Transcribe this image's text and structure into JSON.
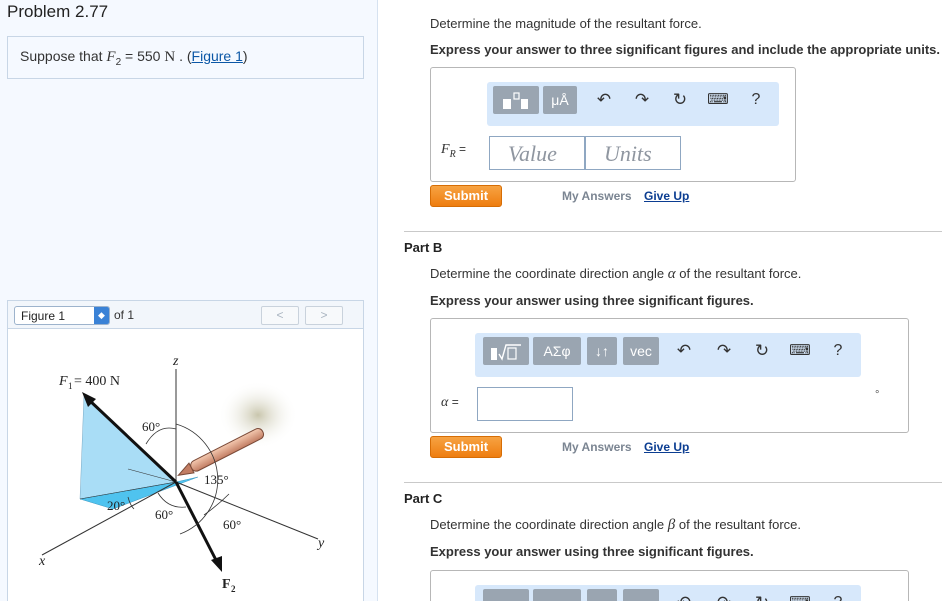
{
  "problem": {
    "title": "Problem 2.77",
    "statement_prefix": "Suppose that ",
    "statement_var": "F",
    "statement_sub": "2",
    "statement_eq": " = 550 ",
    "statement_unit": "N",
    "statement_sep": " . (",
    "figure_link": "Figure 1",
    "statement_suffix": ")"
  },
  "figure_nav": {
    "selected": "Figure 1",
    "of_text": "of 1",
    "prev": "<",
    "next": ">"
  },
  "figure": {
    "f1_label": "F",
    "f1_sub": "1",
    "f1_value": " = 400 N",
    "z_axis": "z",
    "x_axis": "x",
    "y_axis": "y",
    "angle_60a": "60°",
    "angle_135": "135°",
    "angle_20": "20°",
    "angle_60b": "60°",
    "angle_60c": "60°",
    "f2_label": "F",
    "f2_sub": "2"
  },
  "part_a": {
    "question": "Determine the magnitude of the resultant force.",
    "instruction": "Express your answer to three significant figures and include the appropriate units.",
    "toolbar": {
      "units_btn": "μÅ",
      "help": "?"
    },
    "field_label_main": "F",
    "field_label_sub": "R",
    "field_eq": " =",
    "value_placeholder": "Value",
    "units_placeholder": "Units",
    "submit": "Submit",
    "my_answers": "My Answers",
    "give_up": "Give Up"
  },
  "part_b": {
    "title": "Part B",
    "question_prefix": "Determine the coordinate direction angle ",
    "question_var": "α",
    "question_suffix": " of the resultant force.",
    "instruction": "Express your answer using three significant figures.",
    "toolbar": {
      "greek_btn": "ΑΣφ",
      "arrows_btn": "↓↑",
      "vec_btn": "vec",
      "help": "?"
    },
    "field_label": "α",
    "field_eq": " =",
    "unit_symbol": "°",
    "submit": "Submit",
    "my_answers": "My Answers",
    "give_up": "Give Up"
  },
  "part_c": {
    "title": "Part C",
    "question_prefix": "Determine the coordinate direction angle ",
    "question_var": "β",
    "question_suffix": " of the resultant force.",
    "instruction": "Express your answer using three significant figures."
  },
  "colors": {
    "submit": "#f08a1e",
    "toolbar_bg": "#d7e8fb",
    "link": "#0b57a6",
    "face_light": "#a9ddf6",
    "face_dark": "#4fc3ef"
  },
  "icons": [
    "template-icon",
    "undo-icon",
    "redo-icon",
    "reset-icon",
    "keyboard-icon",
    "help-icon",
    "sqrt-template-icon"
  ]
}
